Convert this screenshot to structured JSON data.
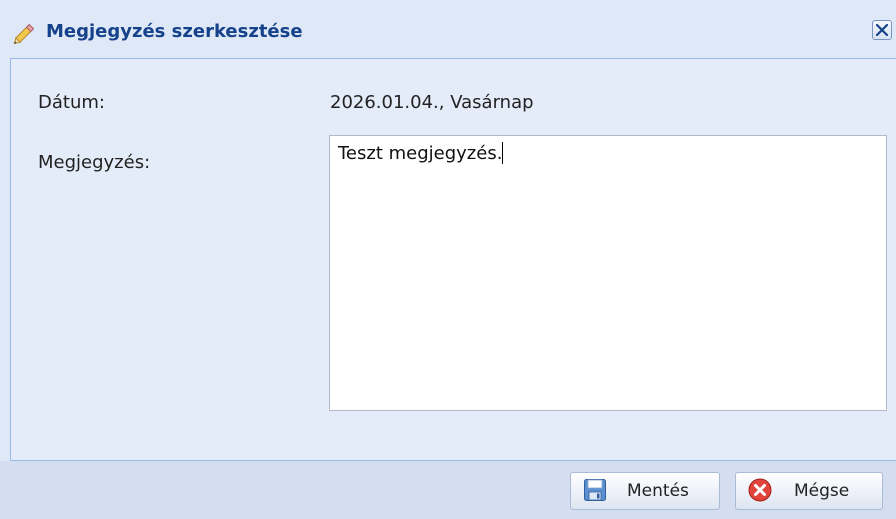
{
  "window": {
    "title": "Megjegyzés szerkesztése",
    "title_icon": "pencil-icon",
    "close_icon": "close-icon"
  },
  "form": {
    "date_label": "Dátum:",
    "date_value": "2026.01.04., Vasárnap",
    "note_label": "Megjegyzés:",
    "note_value": "Teszt megjegyzés."
  },
  "footer": {
    "save_label": "Mentés",
    "save_icon": "floppy-disk-icon",
    "cancel_label": "Mégse",
    "cancel_icon": "cancel-icon"
  },
  "colors": {
    "title_text": "#15428b",
    "window_bg": "#dfe8f6",
    "border": "#99bbe8"
  }
}
